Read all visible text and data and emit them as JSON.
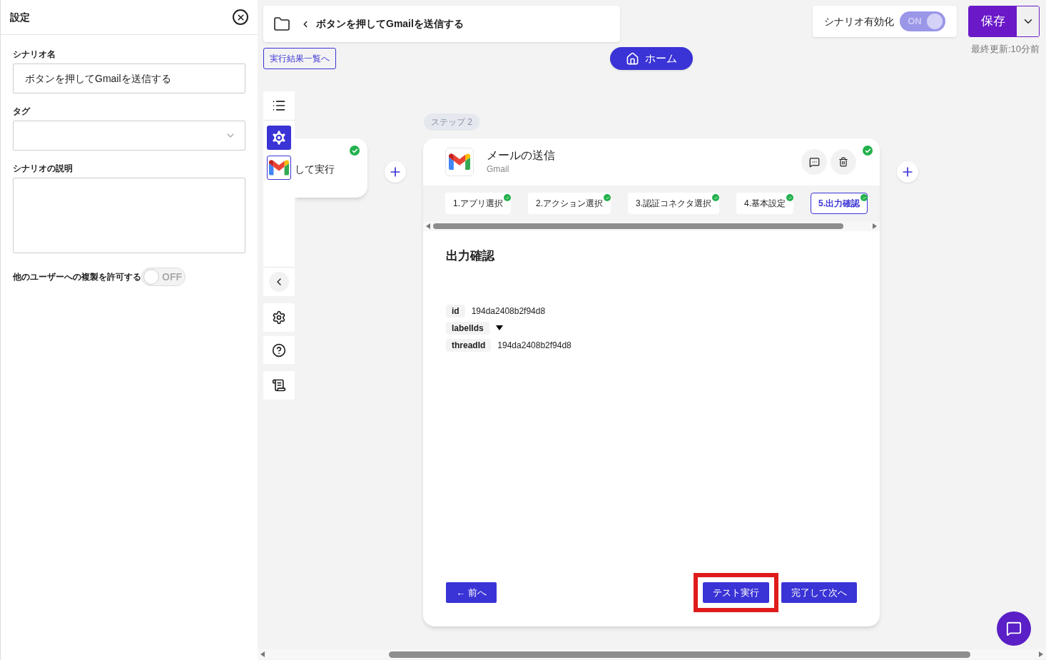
{
  "settings_panel": {
    "title": "設定",
    "fields": [
      {
        "kind": "text",
        "label": "シナリオ名",
        "value": "ボタンを押してGmailを送信する"
      },
      {
        "kind": "select",
        "label": "タグ"
      },
      {
        "kind": "textarea",
        "label": "シナリオの説明"
      }
    ],
    "copy_permission": {
      "label": "他のユーザーへの複製を許可する",
      "on": false,
      "state_text": "OFF"
    }
  },
  "breadcrumb": {
    "title": "ボタンを押してGmailを送信する"
  },
  "results_link": "実行結果一覧へ",
  "home_button": "ホーム",
  "scenario_toggle": {
    "label": "シナリオ有効化",
    "on": true,
    "state_text": "ON"
  },
  "save_button": "保存",
  "last_updated": "最終更新:10分前",
  "prev_node": {
    "text": "して実行",
    "done": true
  },
  "step_badge": "ステップ 2",
  "step_card": {
    "title": "メールの送信",
    "app": "Gmail",
    "done": true,
    "tabs": [
      {
        "label": "1.アプリ選択",
        "done": true,
        "selected": false
      },
      {
        "label": "2.アクション選択",
        "done": true,
        "selected": false
      },
      {
        "label": "3.認証コネクタ選択",
        "done": true,
        "selected": false
      },
      {
        "label": "4.基本設定",
        "done": true,
        "selected": false
      },
      {
        "label": "5.出力確認",
        "done": true,
        "selected": true
      }
    ],
    "section_title": "出力確認",
    "outputs": [
      {
        "kind": "value",
        "key": "id",
        "value": "194da2408b2f94d8"
      },
      {
        "kind": "expandable",
        "key": "labelIds"
      },
      {
        "kind": "value",
        "key": "threadId",
        "value": "194da2408b2f94d8"
      }
    ],
    "buttons": [
      {
        "kind": "back",
        "label": "← 前へ",
        "highlighted": false
      },
      {
        "kind": "primary",
        "label": "テスト実行",
        "highlighted": true
      },
      {
        "kind": "primary",
        "label": "完了して次へ",
        "highlighted": false
      }
    ]
  }
}
